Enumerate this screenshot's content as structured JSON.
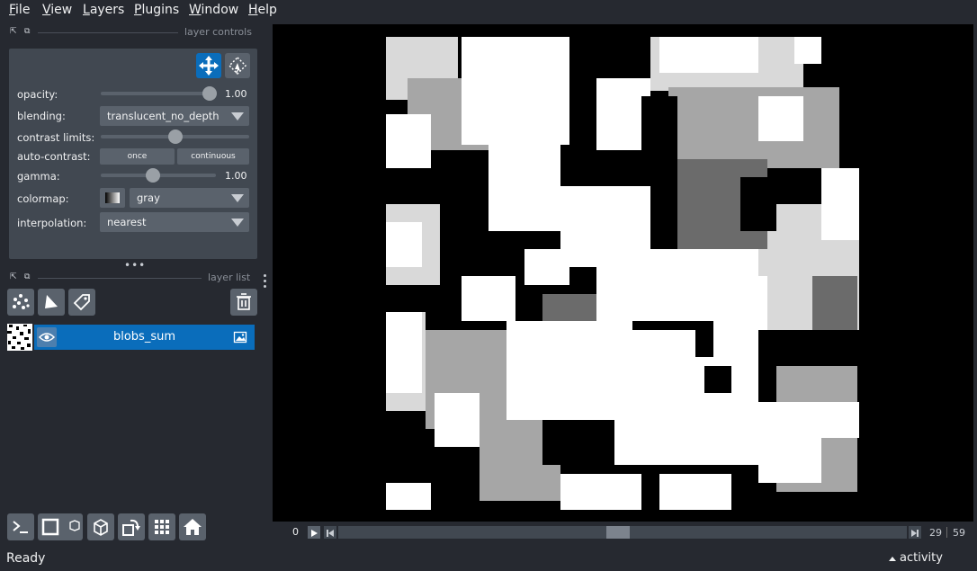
{
  "menu": [
    "File",
    "View",
    "Layers",
    "Plugins",
    "Window",
    "Help"
  ],
  "layer_controls": {
    "title": "layer controls",
    "opacity_label": "opacity:",
    "opacity_value": "1.00",
    "blending_label": "blending:",
    "blending_value": "translucent_no_depth",
    "contrast_label": "contrast limits:",
    "auto_contrast_label": "auto-contrast:",
    "once_label": "once",
    "continuous_label": "continuous",
    "gamma_label": "gamma:",
    "gamma_value": "1.00",
    "colormap_label": "colormap:",
    "colormap_value": "gray",
    "interpolation_label": "interpolation:",
    "interpolation_value": "nearest"
  },
  "layer_list": {
    "title": "layer list",
    "layers": [
      {
        "name": "blobs_sum"
      }
    ]
  },
  "dims": {
    "start": "0",
    "current": "29",
    "max": "59"
  },
  "status": {
    "text": "Ready",
    "activity": "activity"
  },
  "icons": {
    "accent": "#0a6dbb",
    "pan_zoom_active_color": "#0a6dbb"
  }
}
